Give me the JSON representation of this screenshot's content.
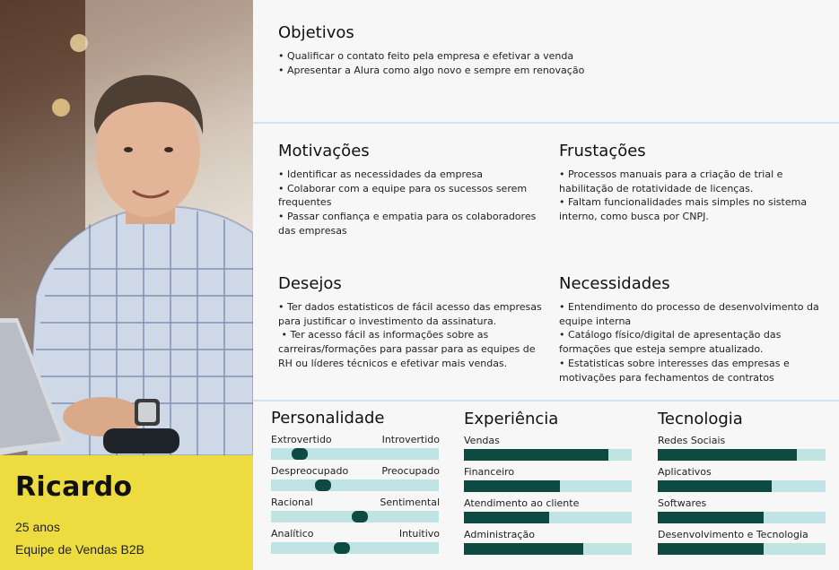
{
  "persona": {
    "name": "Ricardo",
    "age": "25 anos",
    "team": "Equipe de Vendas B2B",
    "photo_icon": "person-photo",
    "accent_color": "#eddc3f"
  },
  "objetivos": {
    "title": "Objetivos",
    "lines": [
      "• Qualificar o contato feito pela empresa e efetivar a venda",
      "• Apresentar a Alura como algo novo e sempre em renovação"
    ]
  },
  "motivacoes": {
    "title": "Motivações",
    "lines": [
      "• Identificar as necessidades da empresa",
      "• Colaborar com a equipe para os sucessos serem",
      "frequentes",
      "• Passar confiança e empatia para os colaboradores",
      "das empresas"
    ]
  },
  "frustacoes": {
    "title": "Frustações",
    "lines": [
      "• Processos manuais para a criação de trial e",
      "habilitação de rotatividade de licenças.",
      "• Faltam funcionalidades mais simples no sistema",
      "interno, como busca por CNPJ."
    ]
  },
  "desejos": {
    "title": "Desejos",
    "lines": [
      "• Ter dados estatisticos de fácil acesso das empresas",
      "para justificar o investimento da assinatura.",
      " • Ter acesso fácil as informações sobre as",
      "carreiras/formações para passar para as equipes de",
      "RH ou líderes técnicos e efetivar mais vendas."
    ]
  },
  "necessidades": {
    "title": "Necessidades",
    "lines": [
      "• Entendimento do processo de desenvolvimento da",
      "equipe interna",
      "• Catálogo físico/digital de apresentação das",
      "formações que esteja sempre atualizado.",
      "• Estatisticas sobre interesses das empresas e",
      "motivações para fechamentos de contratos"
    ]
  },
  "personalidade": {
    "title": "Personalidade",
    "traits": [
      {
        "left": "Extrovertido",
        "right": "Introvertido",
        "level": 0.17
      },
      {
        "left": "Despreocupado",
        "right": "Preocupado",
        "level": 0.31
      },
      {
        "left": "Racional",
        "right": "Sentimental",
        "level": 0.53
      },
      {
        "left": "Analítico",
        "right": "Intuitivo",
        "level": 0.42
      }
    ]
  },
  "experiencia": {
    "title": "Experiência",
    "items": [
      {
        "label": "Vendas",
        "level": 0.86
      },
      {
        "label": "Financeiro",
        "level": 0.57
      },
      {
        "label": "Atendimento ao cliente",
        "level": 0.51
      },
      {
        "label": "Administração",
        "level": 0.71
      }
    ]
  },
  "tecnologia": {
    "title": "Tecnologia",
    "items": [
      {
        "label": "Redes Sociais",
        "level": 0.83
      },
      {
        "label": "Aplicativos",
        "level": 0.68
      },
      {
        "label": "Softwares",
        "level": 0.63
      },
      {
        "label": "Desenvolvimento e Tecnologia",
        "level": 0.63
      }
    ]
  },
  "colors": {
    "bar_fill": "#0c4a42",
    "bar_track": "#bfe4e3"
  }
}
